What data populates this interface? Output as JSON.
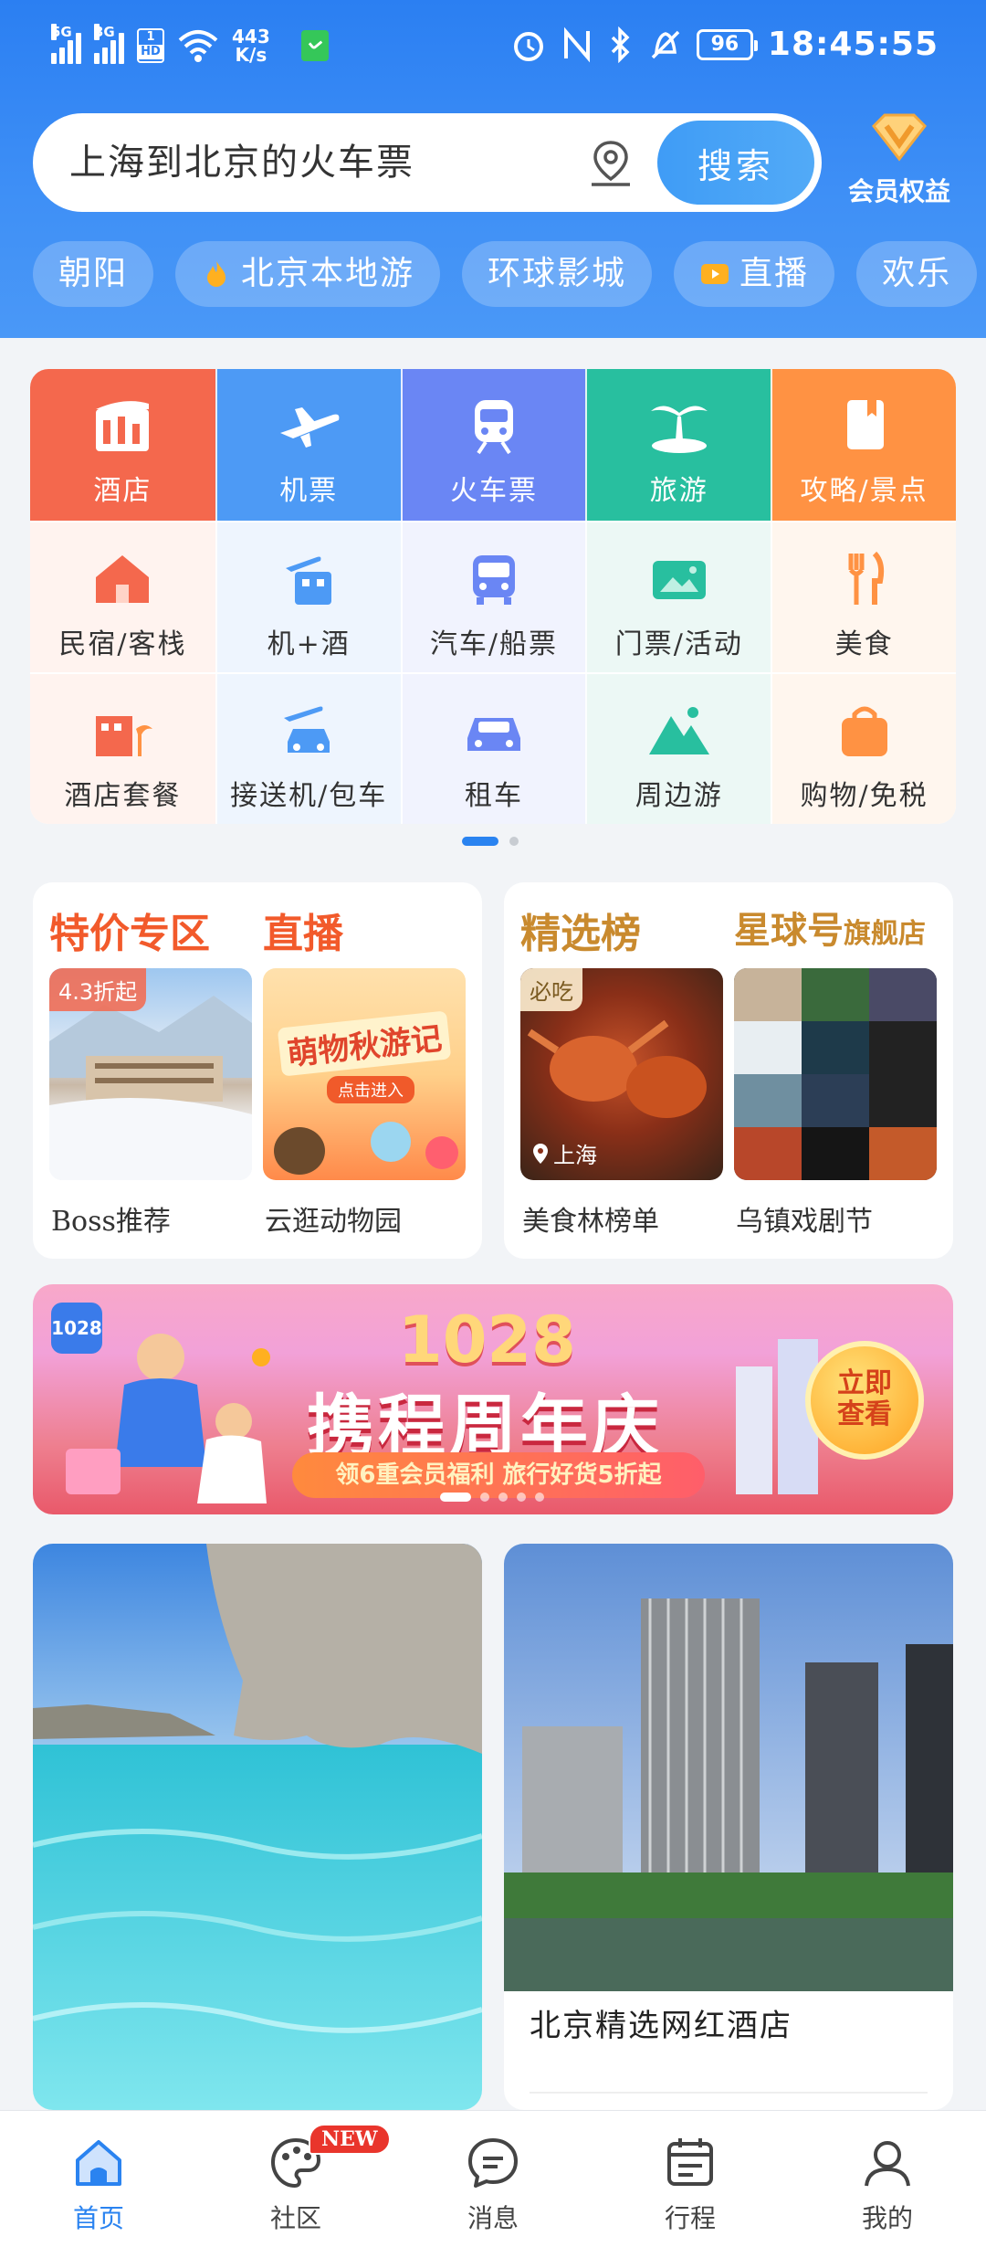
{
  "status_bar": {
    "sim1": "5G",
    "sim2": "3G",
    "hd": "HD",
    "hd_num": "1",
    "wifi_num": "6",
    "speed_value": "443",
    "speed_unit": "K/s",
    "battery": "96",
    "time": "18:45:55"
  },
  "search": {
    "placeholder": "上海到北京的火车票",
    "button": "搜索"
  },
  "member": {
    "label": "会员权益"
  },
  "chips": [
    "朝阳",
    "北京本地游",
    "环球影城",
    "直播",
    "欢乐"
  ],
  "grid": {
    "top": [
      "酒店",
      "机票",
      "火车票",
      "旅游",
      "攻略/景点"
    ],
    "row2": [
      "民宿/客栈",
      "机+酒",
      "汽车/船票",
      "门票/活动",
      "美食"
    ],
    "row3": [
      "酒店套餐",
      "接送机/包车",
      "租车",
      "周边游",
      "购物/免税"
    ]
  },
  "promo_left": {
    "title1": "特价专区",
    "title2": "直播",
    "tag": "4.3折起",
    "img2_text": "萌物秋游记",
    "img2_btn": "点击进入",
    "caption1": "Boss推荐",
    "caption2": "云逛动物园"
  },
  "promo_right": {
    "title1": "精选榜",
    "title2": "星球号",
    "title2_sub": "旗舰店",
    "tag": "必吃",
    "location": "上海",
    "caption1": "美食林榜单",
    "caption2": "乌镇戏剧节"
  },
  "banner": {
    "year": "1028",
    "title": "携程周年庆",
    "strip": "领6重会员福利 旅行好货5折起",
    "button_line1": "立即",
    "button_line2": "查看",
    "logo": "1028"
  },
  "feed": {
    "right_caption": "北京精选网红酒店"
  },
  "tabbar": {
    "new_badge": "NEW",
    "items": [
      "首页",
      "社区",
      "消息",
      "行程",
      "我的"
    ]
  },
  "colors": {
    "accent": "#2a83f0",
    "hotel": "#f4684d",
    "flight": "#4d9af5",
    "train": "#6a86f4",
    "travel": "#28bf9f",
    "guide": "#ff9243"
  }
}
